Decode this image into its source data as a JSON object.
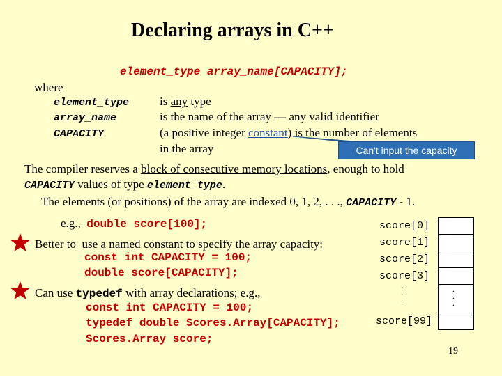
{
  "title": "Declaring arrays in C++",
  "syntax": "element_type array_name[CAPACITY];",
  "where": "where",
  "definitions": [
    {
      "term": "element_type",
      "pre": "is ",
      "underlined": "any",
      "post": " type"
    },
    {
      "term": "array_name",
      "text": "is the name of the array — any valid identifier"
    },
    {
      "term": "CAPACITY",
      "pre": "(a positive integer ",
      "link": "constant",
      "post": ") is the number of elements"
    }
  ],
  "definition_cont": "in the array",
  "callout": "Can't input the capacity",
  "reserve": {
    "pre": "The compiler reserves a ",
    "underlined": "block of consecutive memory locations",
    "post": ", enough to hold",
    "code1": "CAPACITY",
    "mid": " values of type ",
    "code2": "element_type",
    "end": "."
  },
  "indexed": {
    "pre": "The elements (or positions) of the array are indexed 0, 1, 2, . . ., ",
    "code": "CAPACITY",
    "post": " - 1."
  },
  "example": {
    "label": "e.g.,",
    "code": "double score[100];"
  },
  "tip1": {
    "text": "Better to  use a named constant to specify the array capacity:",
    "code1": "const int CAPACITY = 100;",
    "code2": "double score[CAPACITY];"
  },
  "tip2": {
    "pre": "Can use ",
    "kw": "typedef",
    "post": " with array declarations; e.g.,",
    "code1": "const int CAPACITY = 100;",
    "code2": "typedef double Scores.Array[CAPACITY];",
    "code3": "Scores.Array score;"
  },
  "array_labels": [
    "score[0]",
    "score[1]",
    "score[2]",
    "score[3]",
    "score[99]"
  ],
  "dots": ".",
  "page_number": "19",
  "colors": {
    "background": "#FFFFCC",
    "accent": "#C00000",
    "callout": "#2E6FB5",
    "link": "#1F4FA6"
  }
}
